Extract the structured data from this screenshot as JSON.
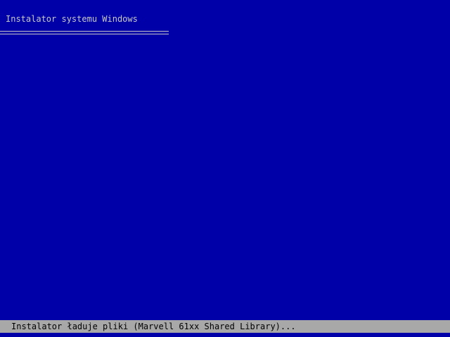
{
  "header": {
    "title": "Instalator systemu Windows"
  },
  "status_bar": {
    "text": "Instalator ładuje pliki (Marvell 61xx Shared Library)..."
  },
  "colors": {
    "background": "#0000a8",
    "text": "#c8c8c8",
    "status_bar_background": "#a8a8a8",
    "status_bar_text": "#000000"
  }
}
